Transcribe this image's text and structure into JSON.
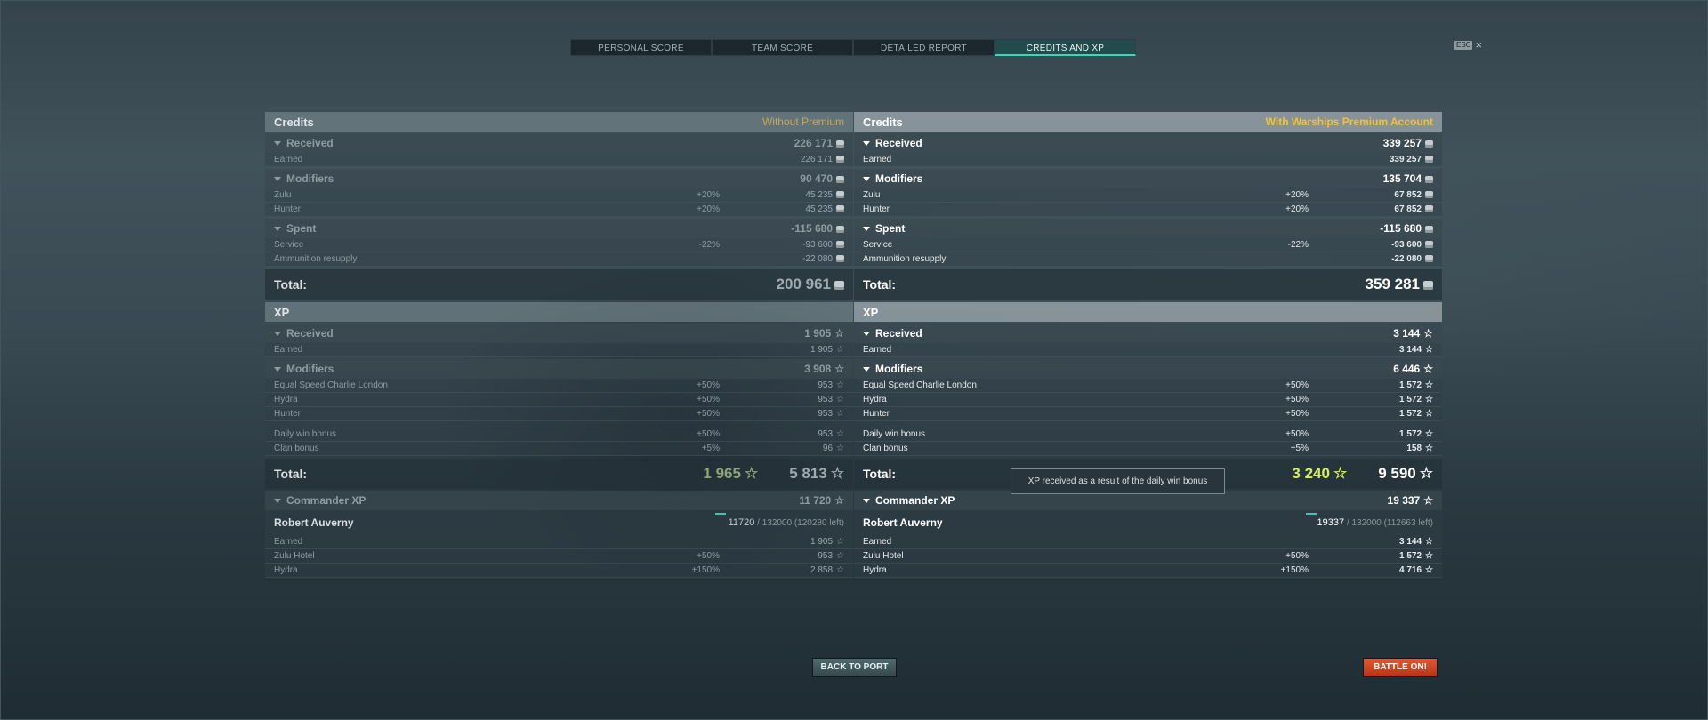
{
  "tabs": [
    "PERSONAL SCORE",
    "TEAM SCORE",
    "DETAILED REPORT",
    "CREDITS AND XP"
  ],
  "active_tab": "CREDITS AND XP",
  "esc": {
    "key": "ESC",
    "close": "×"
  },
  "labels": {
    "credits": "Credits",
    "xp": "XP",
    "received": "Received",
    "modifiers": "Modifiers",
    "spent": "Spent",
    "total": "Total:",
    "commander_xp": "Commander XP"
  },
  "left": {
    "tag": "Without Premium",
    "credits": {
      "received": "226 171",
      "earned": "226 171",
      "modifiers": "90 470",
      "zulu_pct": "+20%",
      "zulu": "45 235",
      "hunter_pct": "+20%",
      "hunter": "45 235",
      "spent": "-115 680",
      "service_pct": "-22%",
      "service": "-93 600",
      "ammo": "-22 080",
      "total": "200 961"
    },
    "xp": {
      "received": "1 905",
      "earned": "1 905",
      "modifiers": "3 908",
      "escl_pct": "+50%",
      "escl": "953",
      "hydra_pct": "+50%",
      "hydra": "953",
      "hunter_pct": "+50%",
      "hunter": "953",
      "daily_pct": "+50%",
      "daily": "953",
      "clan_pct": "+5%",
      "clan": "96",
      "total_free": "1 965",
      "total": "5 813"
    },
    "cmd": {
      "total": "11 720",
      "progress": "11720",
      "progress_rest": " / 132000 (120280 left)",
      "earned": "1 905",
      "zulu_pct": "+50%",
      "zulu": "953",
      "hydra_pct": "+150%",
      "hydra": "2 858"
    }
  },
  "right": {
    "tag": "With Warships Premium Account",
    "credits": {
      "received": "339 257",
      "earned": "339 257",
      "modifiers": "135 704",
      "zulu_pct": "+20%",
      "zulu": "67 852",
      "hunter_pct": "+20%",
      "hunter": "67 852",
      "spent": "-115 680",
      "service_pct": "-22%",
      "service": "-93 600",
      "ammo": "-22 080",
      "total": "359 281"
    },
    "xp": {
      "received": "3 144",
      "earned": "3 144",
      "modifiers": "6 446",
      "escl_pct": "+50%",
      "escl": "1 572",
      "hydra_pct": "+50%",
      "hydra": "1 572",
      "hunter_pct": "+50%",
      "hunter": "1 572",
      "daily_pct": "+50%",
      "daily": "1 572",
      "clan_pct": "+5%",
      "clan": "158",
      "total_free": "3 240",
      "total": "9 590"
    },
    "cmd": {
      "total": "19 337",
      "progress": "19337",
      "progress_rest": " / 132000 (112663 left)",
      "earned": "3 144",
      "zulu_pct": "+50%",
      "zulu": "1 572",
      "hydra_pct": "+150%",
      "hydra": "4 716"
    }
  },
  "rows": {
    "earned": "Earned",
    "zulu": "Zulu",
    "hunter": "Hunter",
    "service": "Service",
    "ammo": "Ammunition resupply",
    "escl": "Equal Speed Charlie London",
    "hydra": "Hydra",
    "daily": "Daily win bonus",
    "clan": "Clan bonus",
    "zulu_hotel": "Zulu Hotel"
  },
  "commander_name": "Robert Auverny",
  "tooltip": "XP received as a result of the daily win bonus",
  "buttons": {
    "back": "BACK TO PORT",
    "battle": "BATTLE ON!"
  }
}
